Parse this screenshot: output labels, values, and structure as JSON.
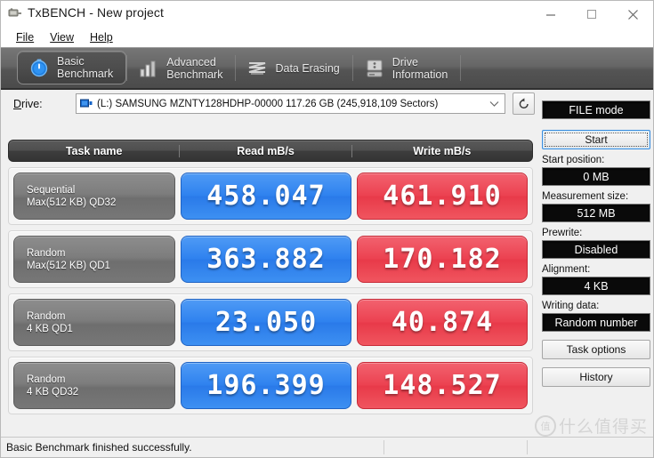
{
  "window": {
    "title": "TxBENCH - New project",
    "icon": "app-icon",
    "controls": {
      "minimize": "minimize",
      "maximize": "maximize",
      "close": "close"
    }
  },
  "menu": {
    "items": [
      {
        "label": "File",
        "accel": "F"
      },
      {
        "label": "View",
        "accel": "V"
      },
      {
        "label": "Help",
        "accel": "H"
      }
    ]
  },
  "tabs": [
    {
      "label": "Basic\nBenchmark",
      "icon": "stopwatch-icon",
      "active": true
    },
    {
      "label": "Advanced\nBenchmark",
      "icon": "bar-chart-icon",
      "active": false
    },
    {
      "label": "Data Erasing",
      "icon": "shred-icon",
      "active": false
    },
    {
      "label": "Drive\nInformation",
      "icon": "hard-drive-icon",
      "active": false
    }
  ],
  "drive": {
    "label": "Drive:",
    "icon": "drive-icon",
    "selected": "(L:) SAMSUNG MZNTY128HDHP-00000   117.26 GB (245,918,109 Sectors)",
    "dropdown_icon": "chevron-down-icon",
    "refresh_icon": "refresh-icon"
  },
  "table": {
    "headers": [
      "Task name",
      "Read mB/s",
      "Write mB/s"
    ],
    "rows": [
      {
        "task": "Sequential\nMax(512 KB) QD32",
        "read": "458.047",
        "write": "461.910"
      },
      {
        "task": "Random\nMax(512 KB) QD1",
        "read": "363.882",
        "write": "170.182"
      },
      {
        "task": "Random\n4 KB QD1",
        "read": "23.050",
        "write": "40.874"
      },
      {
        "task": "Random\n4 KB QD32",
        "read": "196.399",
        "write": "148.527"
      }
    ]
  },
  "side": {
    "mode": "FILE mode",
    "start_button": "Start",
    "start_position_label": "Start position:",
    "start_position_value": "0 MB",
    "measurement_size_label": "Measurement size:",
    "measurement_size_value": "512 MB",
    "prewrite_label": "Prewrite:",
    "prewrite_value": "Disabled",
    "alignment_label": "Alignment:",
    "alignment_value": "4 KB",
    "writing_data_label": "Writing data:",
    "writing_data_value": "Random number",
    "task_options_button": "Task options",
    "history_button": "History"
  },
  "status": {
    "message": "Basic Benchmark finished successfully."
  },
  "watermark": {
    "mark": "值",
    "text": "什么值得买"
  },
  "colors": {
    "read": "#2f82ef",
    "write": "#ec4251",
    "toolbar_top": "#767676",
    "toolbar_bottom": "#4b4b4b",
    "lcd_bg": "#0a0a0a"
  }
}
